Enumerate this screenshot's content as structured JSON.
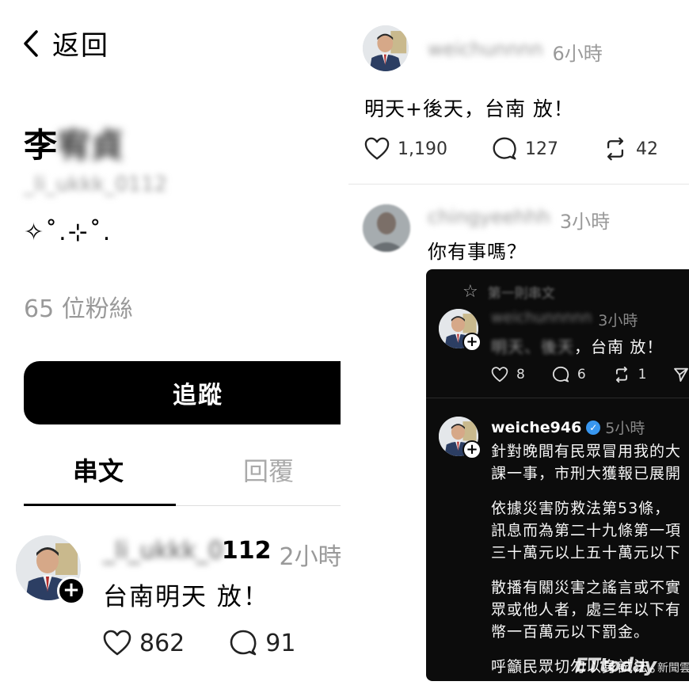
{
  "left_panel": {
    "back_label": "返回",
    "profile_name_visible": "李",
    "profile_name_blurred": "宥貞",
    "profile_handle": "_li_ukkk_0112",
    "bio": "✧˚.⊹˚.",
    "followers": "65 位粉絲",
    "follow_button": "追蹤",
    "tabs": [
      "串文",
      "回覆"
    ],
    "post": {
      "handle_blurred": "_li_ukkk_0",
      "handle_suffix": "112",
      "time": "2小時",
      "text": "台南明天 放！",
      "likes": "862",
      "comments": "91"
    }
  },
  "right_panel": {
    "top_post": {
      "handle_blurred": "weichunnnn",
      "time": "6小時",
      "text": "明天+後天，台南 放！",
      "likes": "1,190",
      "comments": "127",
      "reposts": "42"
    },
    "reply": {
      "handle_blurred": "chingyeehhh",
      "time": "3小時",
      "text": "你有事嗎？"
    },
    "quote_card": {
      "pinned_label": "第一則串文",
      "quote1": {
        "handle_blurred": "weichunnnnn",
        "time": "3小時",
        "text_blurred": "明天、後天",
        "text_visible": "，台南 放！",
        "likes": "8",
        "comments": "6",
        "reposts": "1"
      },
      "quote2": {
        "handle": "weiche946",
        "time": "5小時",
        "paragraphs": [
          [
            "針對晚間有民眾冒用我的大",
            "課一事，市刑大獲報已展開"
          ],
          [
            "依據災害防救法第53條，",
            "訊息而為第二十九條第一項",
            "三十萬元以上五十萬元以下"
          ],
          [
            "散播有關災害之謠言或不實",
            "眾或他人者，處三年以下有",
            "幣一百萬元以下罰金。"
          ],
          [
            "呼籲民眾切勿以身試法。"
          ]
        ]
      }
    },
    "watermark": {
      "main": "ETtoday",
      "sub": "新聞雲"
    }
  }
}
